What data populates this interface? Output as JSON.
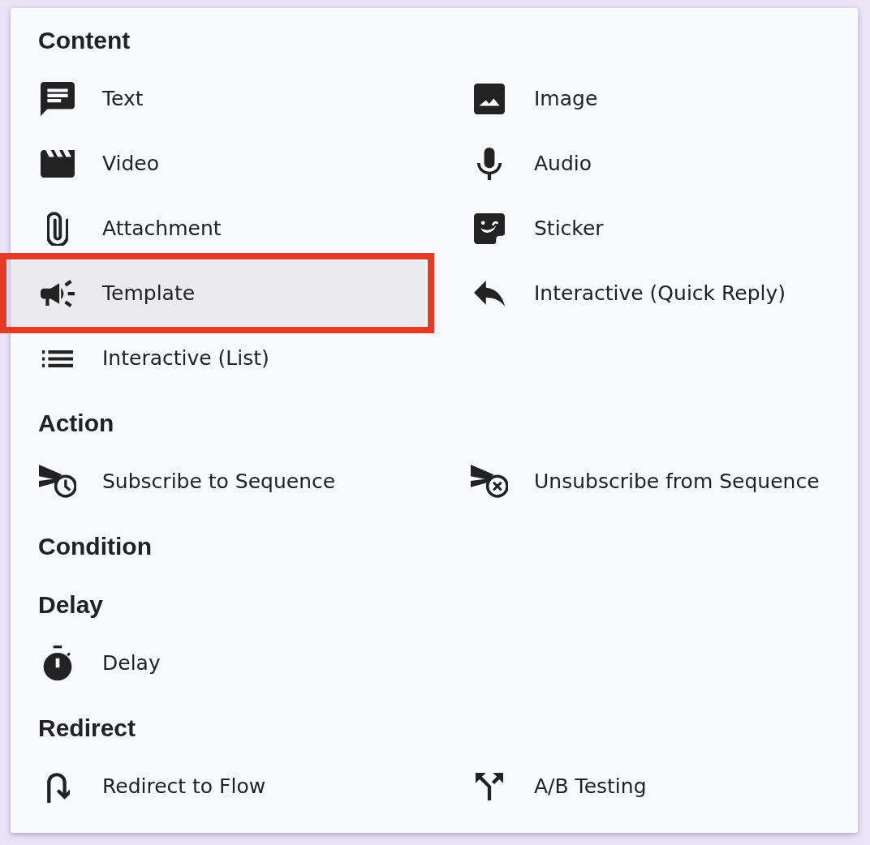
{
  "sections": [
    {
      "title": "Content",
      "items": [
        {
          "kind": "text",
          "label": "Text",
          "selected": false,
          "highlighted": false
        },
        {
          "kind": "image",
          "label": "Image",
          "selected": false,
          "highlighted": false
        },
        {
          "kind": "video",
          "label": "Video",
          "selected": false,
          "highlighted": false
        },
        {
          "kind": "audio",
          "label": "Audio",
          "selected": false,
          "highlighted": false
        },
        {
          "kind": "attachment",
          "label": "Attachment",
          "selected": false,
          "highlighted": false
        },
        {
          "kind": "sticker",
          "label": "Sticker",
          "selected": false,
          "highlighted": false
        },
        {
          "kind": "template",
          "label": "Template",
          "selected": true,
          "highlighted": true
        },
        {
          "kind": "quick_reply",
          "label": "Interactive (Quick Reply)",
          "selected": false,
          "highlighted": false
        },
        {
          "kind": "list",
          "label": "Interactive (List)",
          "selected": false,
          "highlighted": false
        }
      ]
    },
    {
      "title": "Action",
      "items": [
        {
          "kind": "subscribe",
          "label": "Subscribe to Sequence",
          "selected": false,
          "highlighted": false
        },
        {
          "kind": "unsubscribe",
          "label": "Unsubscribe from Sequence",
          "selected": false,
          "highlighted": false
        }
      ]
    },
    {
      "title": "Condition"
    },
    {
      "title": "Delay",
      "items": [
        {
          "kind": "delay",
          "label": "Delay",
          "selected": false,
          "highlighted": false
        }
      ]
    },
    {
      "title": "Redirect",
      "items": [
        {
          "kind": "redirect",
          "label": "Redirect to Flow",
          "selected": false,
          "highlighted": false
        },
        {
          "kind": "split",
          "label": "A/B Testing",
          "selected": false,
          "highlighted": false
        }
      ]
    }
  ]
}
